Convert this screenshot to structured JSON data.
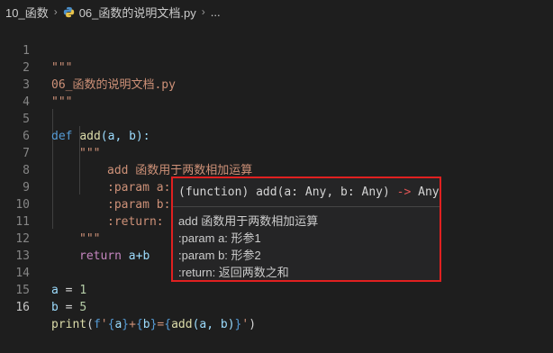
{
  "breadcrumb": {
    "folder": "10_函数",
    "file": "06_函数的说明文档.py",
    "ellipsis": "..."
  },
  "code_lines": [
    {
      "n": "1",
      "text": "\"\"\""
    },
    {
      "n": "2",
      "text": "06_函数的说明文档.py"
    },
    {
      "n": "3",
      "text": "\"\"\""
    },
    {
      "n": "4",
      "text": ""
    },
    {
      "n": "5",
      "text": "def add(a, b):"
    },
    {
      "n": "6",
      "text": "    \"\"\""
    },
    {
      "n": "7",
      "text": "        add 函数用于两数相加运算"
    },
    {
      "n": "8",
      "text": "        :param a: 形参1"
    },
    {
      "n": "9",
      "text": "        :param b: 形参2"
    },
    {
      "n": "10",
      "text": "        :return:"
    },
    {
      "n": "11",
      "text": "    \"\"\""
    },
    {
      "n": "12",
      "text": "    return a+b"
    },
    {
      "n": "13",
      "text": ""
    },
    {
      "n": "14",
      "text": "a = 1"
    },
    {
      "n": "15",
      "text": "b = 5"
    },
    {
      "n": "16",
      "text": "print(f'{a}+{b}={add(a, b)}')"
    }
  ],
  "tokens": {
    "l1": "\"\"\"",
    "l2": "06_函数的说明文档.py",
    "l3": "\"\"\"",
    "l5_def": "def",
    "l5_fn": "add",
    "l5_rest": "(a, b):",
    "l6": "\"\"\"",
    "l7": "add 函数用于两数相加运算",
    "l8": ":param a: 形参1",
    "l9": ":param b: 形参2",
    "l10": ":return:",
    "l11": "\"\"\"",
    "l12_kw": "return",
    "l12_rest": " a+b",
    "l14_var": "a",
    "l14_op": " = ",
    "l14_num": "1",
    "l15_var": "b",
    "l15_op": " = ",
    "l15_num": "5",
    "l16_print": "print",
    "l16_open": "(",
    "l16_f": "f",
    "l16_q1": "'",
    "l16_b1o": "{",
    "l16_a": "a",
    "l16_b1c": "}",
    "l16_plus": "+",
    "l16_b2o": "{",
    "l16_b": "b",
    "l16_b2c": "}",
    "l16_eq": "=",
    "l16_b3o": "{",
    "l16_add": "add",
    "l16_args": "(a, b)",
    "l16_b3c": "}",
    "l16_q2": "'",
    "l16_close": ")"
  },
  "hover": {
    "signature_prefix": "(function) add(a: Any, b: Any) ",
    "signature_arrow": "->",
    "signature_return": " Any",
    "doc": [
      "add 函数用于两数相加运算",
      ":param a: 形参1",
      ":param b: 形参2",
      ":return: 返回两数之和"
    ]
  },
  "colors": {
    "keyword": "#569cd6",
    "function": "#dcdcaa",
    "string": "#ce9178",
    "number": "#b5cea8",
    "variable": "#9cdcfe",
    "highlight_border": "#e02020"
  }
}
